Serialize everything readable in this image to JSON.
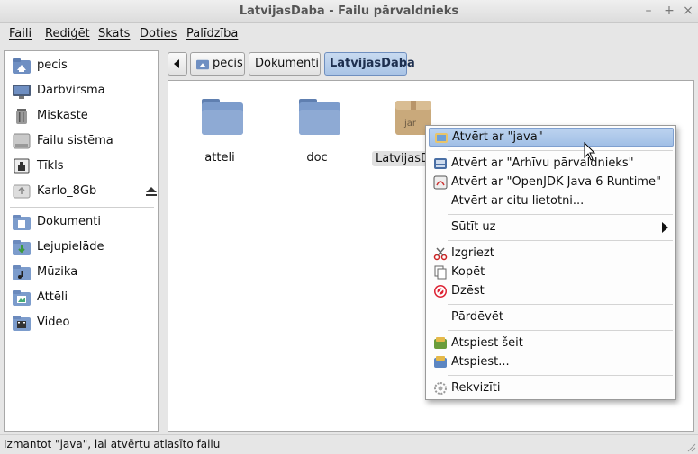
{
  "window": {
    "title": "LatvijasDaba - Failu pārvaldnieks"
  },
  "menubar": [
    "Faili",
    "Rediģēt",
    "Skats",
    "Doties",
    "Palīdzība"
  ],
  "sidebar": {
    "places": [
      {
        "label": "pecis",
        "icon": "home-folder-icon"
      },
      {
        "label": "Darbvirsma",
        "icon": "desktop-icon"
      },
      {
        "label": "Miskaste",
        "icon": "trash-icon"
      },
      {
        "label": "Failu sistēma",
        "icon": "harddisk-icon"
      },
      {
        "label": "Tīkls",
        "icon": "network-icon"
      },
      {
        "label": "Karlo_8Gb",
        "icon": "usb-drive-icon"
      }
    ],
    "bookmarks": [
      {
        "label": "Dokumenti",
        "icon": "documents-folder-icon"
      },
      {
        "label": "Lejupielāde",
        "icon": "downloads-folder-icon"
      },
      {
        "label": "Mūzika",
        "icon": "music-folder-icon"
      },
      {
        "label": "Attēli",
        "icon": "pictures-folder-icon"
      },
      {
        "label": "Video",
        "icon": "video-folder-icon"
      }
    ]
  },
  "pathbar": {
    "segments": [
      "pecis",
      "Dokumenti",
      "LatvijasDaba"
    ]
  },
  "files": [
    {
      "name": "atteli",
      "type": "folder"
    },
    {
      "name": "doc",
      "type": "folder"
    },
    {
      "name": "LatvijasDaba",
      "type": "jar",
      "badge": "jar"
    }
  ],
  "context_menu": {
    "items": [
      {
        "label": "Atvērt ar \"java\"",
        "icon": "java-icon"
      },
      {
        "label": "Atvērt ar \"Arhīvu pārvaldnieks\"",
        "icon": "archive-manager-icon"
      },
      {
        "label": "Atvērt ar \"OpenJDK Java 6 Runtime\"",
        "icon": "openjdk-icon"
      },
      {
        "label": "Atvērt ar citu lietotni..."
      },
      {
        "label": "Sūtīt uz"
      },
      {
        "label": "Izgriezt",
        "icon": "cut-icon"
      },
      {
        "label": "Kopēt",
        "icon": "copy-icon"
      },
      {
        "label": "Dzēst",
        "icon": "delete-icon"
      },
      {
        "label": "Pārdēvēt"
      },
      {
        "label": "Atspiest šeit",
        "icon": "extract-here-icon"
      },
      {
        "label": "Atspiest...",
        "icon": "extract-icon"
      },
      {
        "label": "Rekvizīti",
        "icon": "properties-icon"
      }
    ]
  },
  "statusbar": {
    "text": "Izmantot \"java\", lai atvērtu atlasīto failu"
  },
  "colors": {
    "highlight": "#a9c4e6",
    "folder": "#7c9ccc"
  }
}
